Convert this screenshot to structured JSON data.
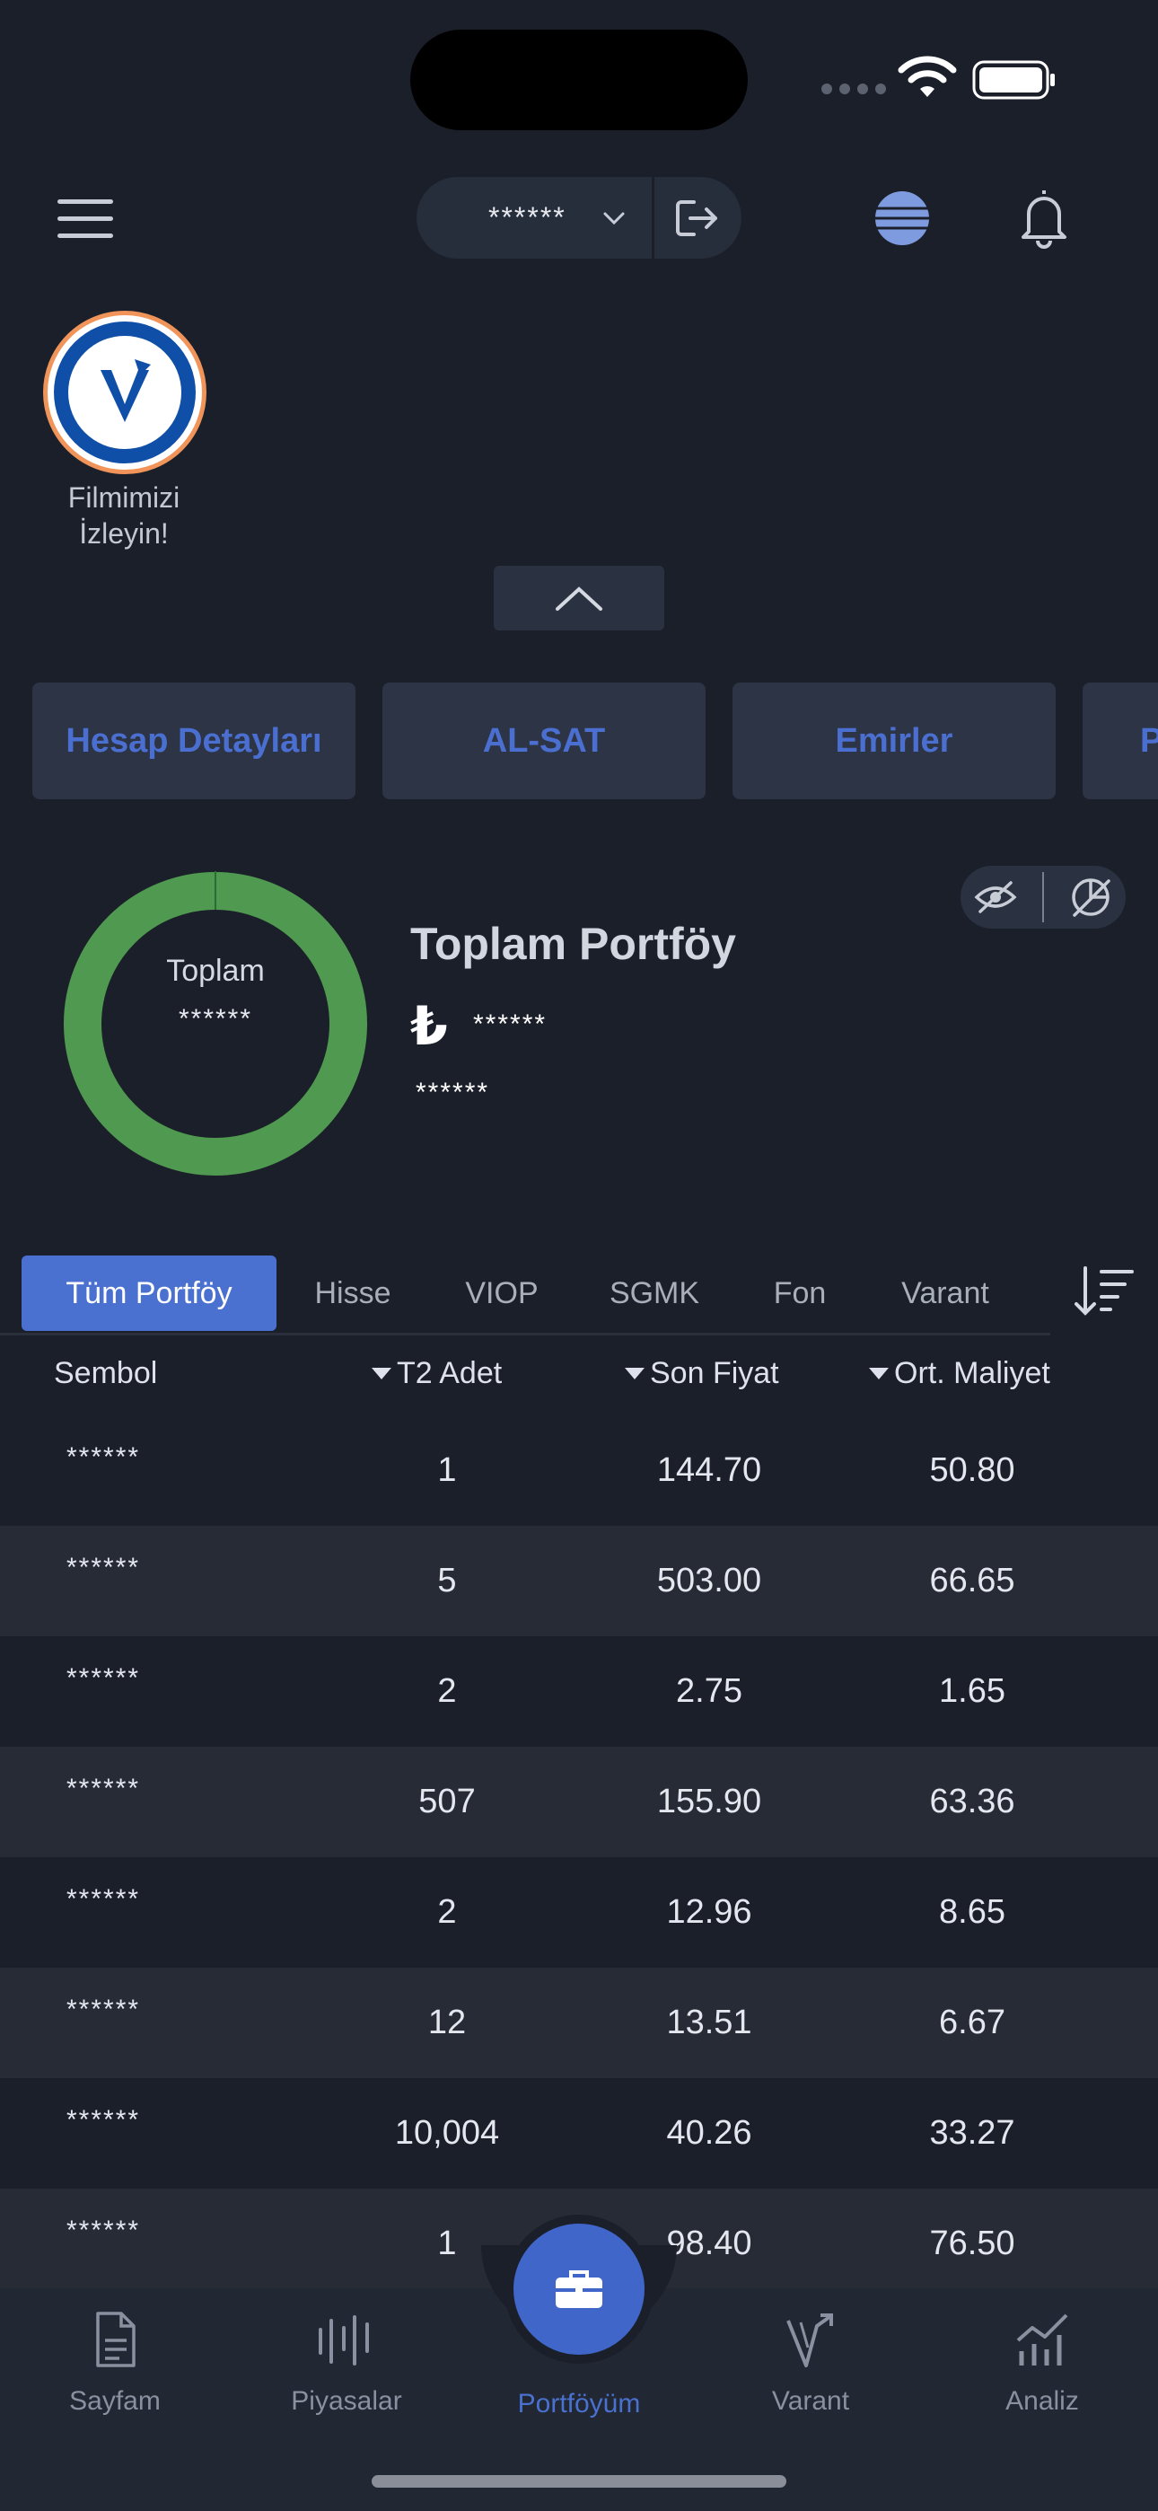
{
  "header": {
    "account_masked": "******"
  },
  "story": {
    "label": "Filmimizi\nİzleyin!"
  },
  "quick_buttons": [
    "Hesap Detayları",
    "AL-SAT",
    "Emirler",
    "P"
  ],
  "portfolio": {
    "donut_label": "Toplam",
    "donut_value": "******",
    "title": "Toplam Portföy",
    "currency_sign": "₺",
    "total_value": "******",
    "sub_value": "******",
    "donut_color": "#4f9a50"
  },
  "tabs": [
    {
      "label": "Tüm Portföy",
      "active": true
    },
    {
      "label": "Hisse",
      "active": false
    },
    {
      "label": "VIOP",
      "active": false
    },
    {
      "label": "SGMK",
      "active": false
    },
    {
      "label": "Fon",
      "active": false
    },
    {
      "label": "Varant",
      "active": false
    }
  ],
  "table": {
    "columns": [
      "Sembol",
      "T2 Adet",
      "Son Fiyat",
      "Ort. Maliyet"
    ],
    "rows": [
      {
        "symbol": "******",
        "t2": "1",
        "price": "144.70",
        "cost": "50.80"
      },
      {
        "symbol": "******",
        "t2": "5",
        "price": "503.00",
        "cost": "66.65"
      },
      {
        "symbol": "******",
        "t2": "2",
        "price": "2.75",
        "cost": "1.65"
      },
      {
        "symbol": "******",
        "t2": "507",
        "price": "155.90",
        "cost": "63.36"
      },
      {
        "symbol": "******",
        "t2": "2",
        "price": "12.96",
        "cost": "8.65"
      },
      {
        "symbol": "******",
        "t2": "12",
        "price": "13.51",
        "cost": "6.67"
      },
      {
        "symbol": "******",
        "t2": "10,004",
        "price": "40.26",
        "cost": "33.27"
      },
      {
        "symbol": "******",
        "t2": "1",
        "price": "98.40",
        "cost": "76.50"
      }
    ]
  },
  "nav": {
    "items": [
      "Sayfam",
      "Piyasalar",
      "Portföyüm",
      "Varant",
      "Analiz"
    ],
    "active_color": "#4a71cf"
  }
}
